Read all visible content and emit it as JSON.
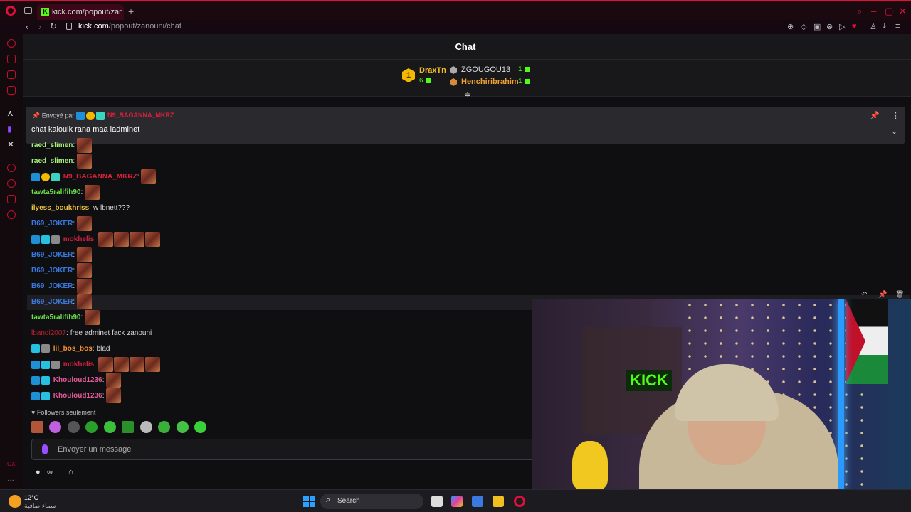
{
  "browser": {
    "tab_title": "kick.com/popout/zanouni",
    "new_tab": "+",
    "url_prefix": "kick.com",
    "url_path": "/popout/zanouni/chat"
  },
  "chat": {
    "title": "Chat",
    "leaderboard": {
      "first": {
        "rank": "1",
        "name": "DraxTn",
        "count": "6"
      },
      "second": {
        "name": "ZGOUGOU13",
        "count": "1"
      },
      "third": {
        "name": "Henchiribrahim",
        "count": "1"
      }
    },
    "pinned": {
      "sent_by": "Envoyé par",
      "author": "N9_BAGANNA_MKRZ",
      "message": "chat kaloulk rana maa ladminet"
    },
    "lines": [
      {
        "user": "raed_slimen",
        "color": "#a8f07a",
        "text": "",
        "emotes": 1
      },
      {
        "user": "raed_slimen",
        "color": "#a8f07a",
        "text": "",
        "emotes": 1
      },
      {
        "user": "N9_BAGANNA_MKRZ",
        "color": "#e0203a",
        "text": "",
        "emotes": 1
      },
      {
        "user": "tawta5ralifih90",
        "color": "#6ae04a",
        "text": "",
        "emotes": 1
      },
      {
        "user": "ilyess_boukhriss",
        "color": "#f0c040",
        "text": "w lbnett???",
        "emotes": 0
      },
      {
        "user": "B69_JOKER",
        "color": "#3a7ae0",
        "text": "",
        "emotes": 1
      },
      {
        "user": "mokhelis",
        "color": "#d02040",
        "text": "",
        "emotes": 4
      },
      {
        "user": "B69_JOKER",
        "color": "#3a7ae0",
        "text": "",
        "emotes": 1
      },
      {
        "user": "B69_JOKER",
        "color": "#3a7ae0",
        "text": "",
        "emotes": 1
      },
      {
        "user": "B69_JOKER",
        "color": "#3a7ae0",
        "text": "",
        "emotes": 1
      },
      {
        "user": "B69_JOKER",
        "color": "#3a7ae0",
        "text": "",
        "emotes": 1
      },
      {
        "user": "tawta5ralifih90",
        "color": "#6ae04a",
        "text": "",
        "emotes": 1
      },
      {
        "user": "lbandi2007",
        "color": "#c02030",
        "text": "free adminet fack zanouni",
        "emotes": 0
      },
      {
        "user": "lil_bos_bos",
        "color": "#f09030",
        "text": "blad",
        "emotes": 0
      },
      {
        "user": "mokhelis",
        "color": "#d02040",
        "text": "",
        "emotes": 4
      },
      {
        "user": "Khouloud1236",
        "color": "#e05a9a",
        "text": "",
        "emotes": 1
      },
      {
        "user": "Khouloud1236",
        "color": "#e05a9a",
        "text": "",
        "emotes": 1
      }
    ],
    "followers_only": "Followers seulement",
    "input_placeholder": "Envoyer un message"
  },
  "webcam": {
    "sign_text": "KICK"
  },
  "taskbar": {
    "temperature": "12°C",
    "weather": "سماء صافية",
    "search_label": "Search"
  }
}
